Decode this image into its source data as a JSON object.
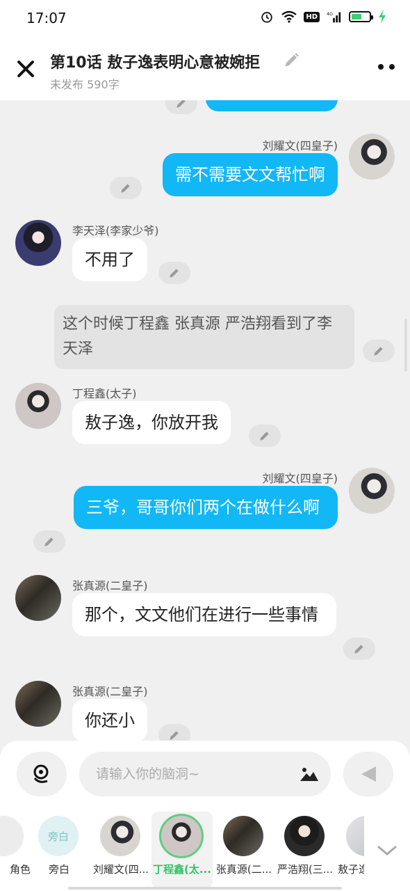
{
  "status": {
    "time": "17:07",
    "network": "4G",
    "hd": "HD"
  },
  "header": {
    "title": "第10话  敖子逸表明心意被婉拒",
    "subtitle": "未发布 590字"
  },
  "messages": [
    {
      "side": "right",
      "name": "刘耀文(四皇子)",
      "text": "需不需要文文帮忙啊"
    },
    {
      "side": "left",
      "name": "李天泽(李家少爷)",
      "text": "不用了"
    },
    {
      "side": "narration",
      "text": "这个时候丁程鑫  张真源  严浩翔看到了李天泽"
    },
    {
      "side": "left",
      "name": "丁程鑫(太子)",
      "text": "敖子逸，你放开我"
    },
    {
      "side": "right",
      "name": "刘耀文(四皇子)",
      "text": "三爷，哥哥你们两个在做什么啊"
    },
    {
      "side": "left",
      "name": "张真源(二皇子)",
      "text": "那个，文文他们在进行一些事情"
    },
    {
      "side": "left",
      "name": "张真源(二皇子)",
      "text": "你还小"
    }
  ],
  "composer": {
    "placeholder": "请输入你的脑洞~"
  },
  "roles": [
    {
      "label": "角色"
    },
    {
      "label": "旁白",
      "avatar_text": "旁白"
    },
    {
      "label": "刘耀文(四..."
    },
    {
      "label": "丁程鑫(太...",
      "selected": true
    },
    {
      "label": "张真源(二..."
    },
    {
      "label": "严浩翔(三..."
    },
    {
      "label": "敖子逸"
    }
  ],
  "colors": {
    "accent_blue": "#12b7f5",
    "selected_green": "#38c36a",
    "background": "#f0f0f0"
  }
}
